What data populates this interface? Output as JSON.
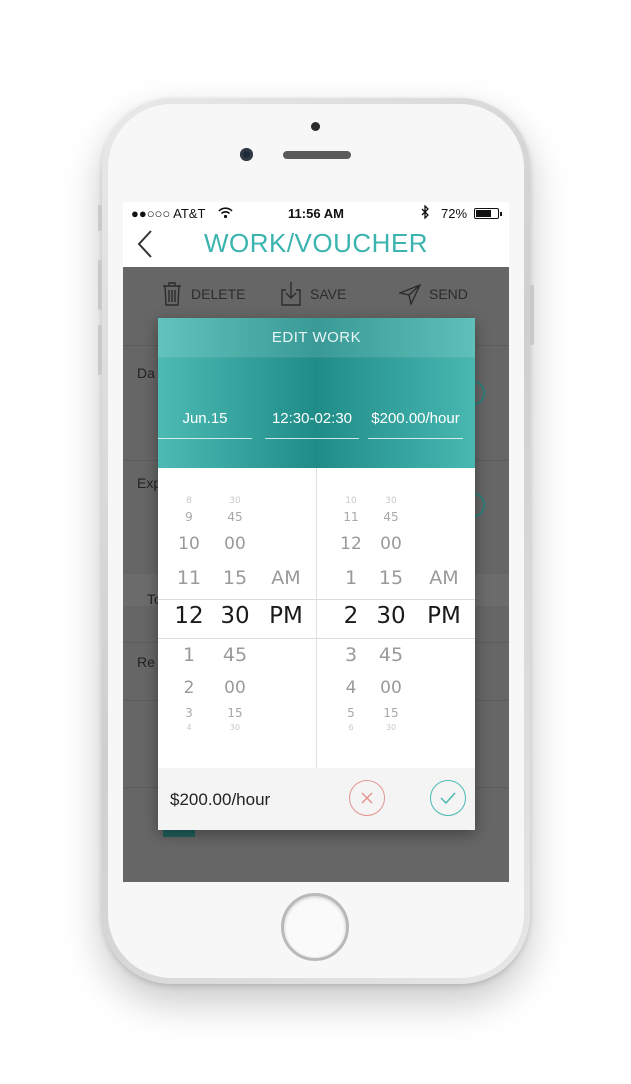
{
  "status_bar": {
    "carrier": "●●○○○ AT&T",
    "time": "11:56 AM",
    "battery_pct": "72%",
    "battery_level": 0.72
  },
  "nav": {
    "back_icon": "chevron-left-icon",
    "title": "WORK/VOUCHER"
  },
  "toolbar": {
    "delete_label": "DELETE",
    "save_label": "SAVE",
    "send_label": "SEND"
  },
  "background_form": {
    "label_1": "Da",
    "label_2": "Exp",
    "label_3": "To",
    "label_4": "Re"
  },
  "modal": {
    "title": "EDIT WORK",
    "date": "Jun.15",
    "time_range": "12:30-02:30",
    "rate_field": "$200.00/hour",
    "footer_rate": "$200.00/hour",
    "cancel_icon": "close-icon",
    "confirm_icon": "check-icon"
  },
  "picker": {
    "start": {
      "hours": [
        "8",
        "9",
        "10",
        "11",
        "12",
        "1",
        "2",
        "3",
        "4"
      ],
      "minutes": [
        "30",
        "45",
        "00",
        "15",
        "30",
        "45",
        "00",
        "15",
        "30"
      ],
      "ampm": [
        "AM",
        "PM"
      ]
    },
    "end": {
      "hours": [
        "10",
        "11",
        "12",
        "1",
        "2",
        "3",
        "4",
        "5",
        "6"
      ],
      "minutes": [
        "30",
        "45",
        "00",
        "15",
        "30",
        "45",
        "00",
        "15",
        "30"
      ],
      "ampm": [
        "AM",
        "PM"
      ]
    }
  },
  "colors": {
    "accent": "#3bb3ae",
    "header_dark": "#1f8c88",
    "cancel": "#e2958f",
    "confirm": "#4ab9b3"
  }
}
